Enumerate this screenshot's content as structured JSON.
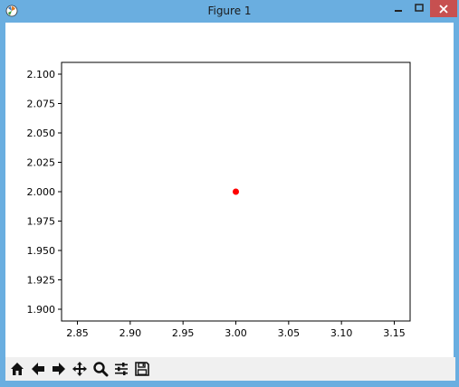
{
  "window": {
    "title": "Figure 1",
    "minimize_icon": "minimize-icon",
    "maximize_icon": "maximize-icon",
    "close_icon": "close-icon"
  },
  "toolbar": {
    "buttons": [
      {
        "name": "home",
        "icon": "home-icon"
      },
      {
        "name": "back",
        "icon": "arrow-left-icon"
      },
      {
        "name": "forward",
        "icon": "arrow-right-icon"
      },
      {
        "name": "pan",
        "icon": "move-icon"
      },
      {
        "name": "zoom",
        "icon": "zoom-icon"
      },
      {
        "name": "configure-subplots",
        "icon": "sliders-icon"
      },
      {
        "name": "save",
        "icon": "save-icon"
      }
    ]
  },
  "chart_data": {
    "type": "scatter",
    "x": [
      3.0
    ],
    "y": [
      2.0
    ],
    "point_color": "#ff0000",
    "xlim": [
      2.835,
      3.165
    ],
    "ylim": [
      1.89,
      2.11
    ],
    "xticks": [
      "2.85",
      "2.90",
      "2.95",
      "3.00",
      "3.05",
      "3.10",
      "3.15"
    ],
    "yticks": [
      "1.900",
      "1.925",
      "1.950",
      "1.975",
      "2.000",
      "2.025",
      "2.050",
      "2.075",
      "2.100"
    ],
    "title": "",
    "xlabel": "",
    "ylabel": "",
    "grid": false
  }
}
